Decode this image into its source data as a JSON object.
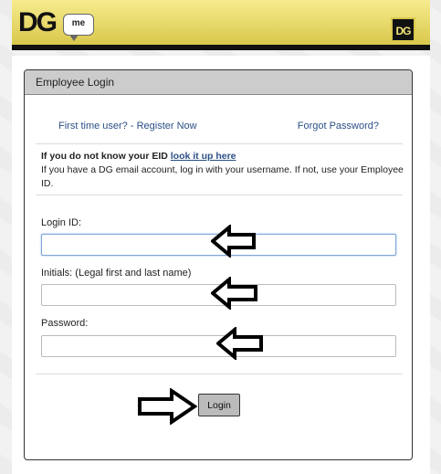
{
  "header": {
    "logo_text": "DG",
    "logo_badge": "me",
    "corner_logo": "DG"
  },
  "panel": {
    "title": "Employee Login"
  },
  "links": {
    "register": "First time user? - Register Now",
    "forgot": "Forgot Password?"
  },
  "eid": {
    "lead": "If you do not know your EID",
    "link": "look it up here",
    "note": "If you have a DG email account, log in with your username. If not, use your Employee ID."
  },
  "form": {
    "login_id_label": "Login ID:",
    "login_id_value": "",
    "initials_label": "Initials: (Legal first and last name)",
    "initials_value": "",
    "password_label": "Password:",
    "password_value": "",
    "submit_label": "Login"
  },
  "annotations": {
    "arrow_icon": "left-arrow-outline-icon",
    "submit_arrow_icon": "right-arrow-outline-icon"
  }
}
